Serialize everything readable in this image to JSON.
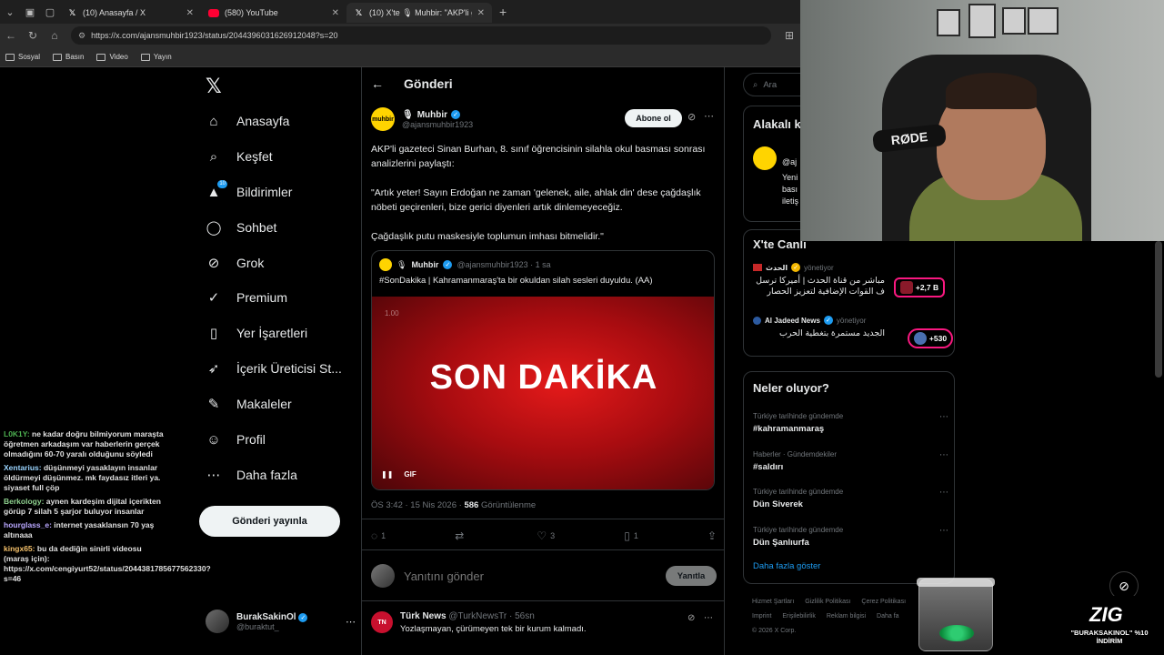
{
  "browser": {
    "tabs": [
      {
        "label": "(10) Anasayfa / X",
        "icon": "x-icon",
        "active": false
      },
      {
        "label": "(580) YouTube",
        "icon": "youtube-icon",
        "active": false
      },
      {
        "label": "(10) X'te 🎙 Muhbir: \"AKP'li gazete",
        "icon": "x-icon",
        "active": true
      }
    ],
    "url": "https://x.com/ajansmuhbir1923/status/2044396031626912048?s=20",
    "bookmarks": [
      "Sosyal",
      "Basın",
      "Video",
      "Yayın"
    ]
  },
  "nav": {
    "items": [
      {
        "label": "Anasayfa",
        "icon": "home-icon",
        "glyph": "⌂"
      },
      {
        "label": "Keşfet",
        "icon": "search-icon",
        "glyph": "⌕"
      },
      {
        "label": "Bildirimler",
        "icon": "bell-icon",
        "glyph": "🔔",
        "badge": "10"
      },
      {
        "label": "Sohbet",
        "icon": "chat-icon",
        "glyph": "◯"
      },
      {
        "label": "Grok",
        "icon": "grok-icon",
        "glyph": "⊘"
      },
      {
        "label": "Premium",
        "icon": "premium-icon",
        "glyph": "✓"
      },
      {
        "label": "Yer İşaretleri",
        "icon": "bookmark-icon",
        "glyph": "▯"
      },
      {
        "label": "İçerik Üreticisi St...",
        "icon": "rocket-icon",
        "glyph": "➶"
      },
      {
        "label": "Makaleler",
        "icon": "article-icon",
        "glyph": "✎"
      },
      {
        "label": "Profil",
        "icon": "profile-icon",
        "glyph": "☺"
      },
      {
        "label": "Daha fazla",
        "icon": "more-circle-icon",
        "glyph": "⋯"
      }
    ],
    "post_button": "Gönderi yayınla",
    "account": {
      "name": "BurakSakinOl",
      "handle": "@buraktut_"
    }
  },
  "chat": [
    {
      "user": "L0K1Y:",
      "text": "ne kadar doğru bilmiyorum maraşta öğretmen arkadaşım var haberlerin gerçek olmadığını 60-70 yaralı olduğunu söyledi"
    },
    {
      "user": "Xentarius:",
      "text": "düşünmeyi yasaklayın insanlar öldürmeyi düşünmez. mk faydasız itleri ya. siyaset full çöp"
    },
    {
      "user": "Berkology:",
      "text": "aynen kardeşim dijital içerikten görüp 7 silah 5 şarjor buluyor insanlar"
    },
    {
      "user": "hourglass_e:",
      "text": "internet yasaklansın 70 yaş altınaaa"
    },
    {
      "user": "kingx65:",
      "text": "bu da dediğin sinirli videosu (maraş için): https://x.com/cengiyurt52/status/2044381785677562330?s=46"
    }
  ],
  "main": {
    "header_title": "Gönderi",
    "author": {
      "name": "Muhbir",
      "handle": "@ajansmuhbir1923",
      "avatar_text": "muhbir"
    },
    "follow_label": "Abone ol",
    "paragraphs": [
      "AKP'li gazeteci Sinan Burhan, 8. sınıf öğrencisinin silahla okul basması sonrası analizlerini paylaştı:",
      "\"Artık yeter! Sayın Erdoğan ne zaman 'gelenek, aile, ahlak din' dese çağdaşlık nöbeti geçirenleri, bize gerici diyenleri  artık dinlemeyeceğiz.",
      "Çağdaşlık putu maskesiyle toplumun imhası bitmelidir.\""
    ],
    "quote": {
      "name": "Muhbir",
      "handle": "@ajansmuhbir1923 · 1 sa",
      "text": "#SonDakika | Kahramanmaraş'ta bir okuldan silah sesleri duyuldu. (AA)",
      "media_timestamp": "1.00",
      "media_headline": "SON DAKİKA",
      "gif_label": "GIF"
    },
    "meta": {
      "time": "ÖS 3:42 · 15 Nis 2026 · ",
      "views": "586",
      "views_label": " Görüntülenme"
    },
    "actions": {
      "replies": "1",
      "retweets": "",
      "likes": "3",
      "bookmarks": "1"
    },
    "reply_placeholder": "Yanıtını gönder",
    "reply_button": "Yanıtla",
    "next_post": {
      "name": "Türk News",
      "handle": "@TurkNewsTr · 56sn",
      "text": "Yozlaşmayan, çürümeyen tek bir kurum kalmadı."
    }
  },
  "right": {
    "search_placeholder": "Ara",
    "related_title": "Alakalı k",
    "related_bio": "Yeni\nbası\niletiş",
    "related_handle": "@aj",
    "live_title": "X'te Canlı",
    "live": [
      {
        "source": "الحدث",
        "status": "yönetiyor",
        "title": "مباشر من قناة الحدث | أميركا ترسل ف القوات الإضافية لتعزيز الحصار",
        "count": "+2,7 B"
      },
      {
        "source": "Al Jadeed News",
        "status": "yönetiyor",
        "title": "الجديد مستمرة بتغطية الحرب",
        "count": "+530"
      }
    ],
    "trends_title": "Neler oluyor?",
    "trends": [
      {
        "category": "Türkiye tarihinde gündemde",
        "name": "#kahramanmaraş"
      },
      {
        "category": "Haberler · Gündemdekiler",
        "name": "#saldırı"
      },
      {
        "category": "Türkiye tarihinde gündemde",
        "name": "Dün Siverek"
      },
      {
        "category": "Türkiye tarihinde gündemde",
        "name": "Dün Şanlıurfa"
      }
    ],
    "show_more": "Daha fazla göster",
    "footer": [
      "Hizmet Şartları",
      "Gizlilik Politikası",
      "Çerez Politikası",
      "Imprint",
      "Erişilebilirlik",
      "Reklam bilgisi",
      "Daha fa",
      "© 2026 X Corp."
    ]
  },
  "overlay": {
    "mic_brand": "RØDE",
    "promo_logo": "ZIG",
    "promo_text": "\"BURAKSAKINOL\" %10 İNDİRİM"
  },
  "colors": {
    "accent": "#1d9bf0",
    "live": "#f91880",
    "media_red": "#e41a1a"
  }
}
